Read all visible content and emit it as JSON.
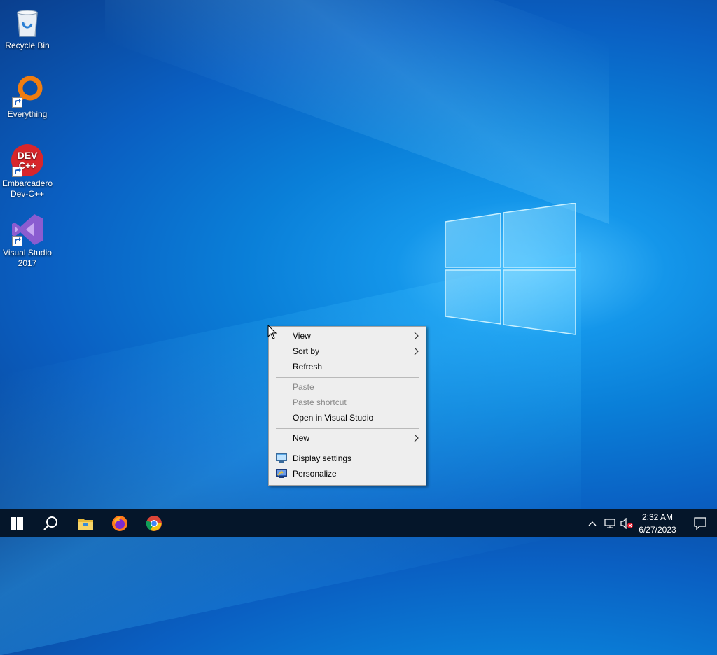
{
  "desktop": {
    "icons": [
      {
        "label": "Recycle Bin",
        "icon": "recycle-bin-icon"
      },
      {
        "label": "Everything",
        "icon": "everything-search-icon"
      },
      {
        "label": "Embarcadero Dev-C++",
        "line1": "Embarcadero",
        "line2": "Dev-C++",
        "icon": "devcpp-icon",
        "badge_text": "DEV C++"
      },
      {
        "label": "Visual Studio 2017",
        "line1": "Visual Studio",
        "line2": "2017",
        "icon": "visual-studio-icon"
      }
    ]
  },
  "context_menu": {
    "items": [
      {
        "label": "View",
        "has_submenu": true,
        "enabled": true
      },
      {
        "label": "Sort by",
        "has_submenu": true,
        "enabled": true
      },
      {
        "label": "Refresh",
        "enabled": true
      },
      {
        "label": "Paste",
        "enabled": false
      },
      {
        "label": "Paste shortcut",
        "enabled": false
      },
      {
        "label": "Open in Visual Studio",
        "enabled": true
      },
      {
        "label": "New",
        "has_submenu": true,
        "enabled": true
      },
      {
        "label": "Display settings",
        "icon": "display-icon",
        "enabled": true
      },
      {
        "label": "Personalize",
        "icon": "personalize-icon",
        "enabled": true
      }
    ]
  },
  "taskbar": {
    "buttons": [
      "start-icon",
      "search-icon",
      "file-explorer-icon",
      "firefox-icon",
      "chrome-icon"
    ],
    "tray": {
      "time": "2:32 AM",
      "date": "6/27/2023",
      "icons": [
        "show-hidden-icons-chevron",
        "network-icon",
        "volume-muted-icon",
        "notifications-icon"
      ]
    },
    "colors": {
      "bar": "#05162a"
    }
  }
}
